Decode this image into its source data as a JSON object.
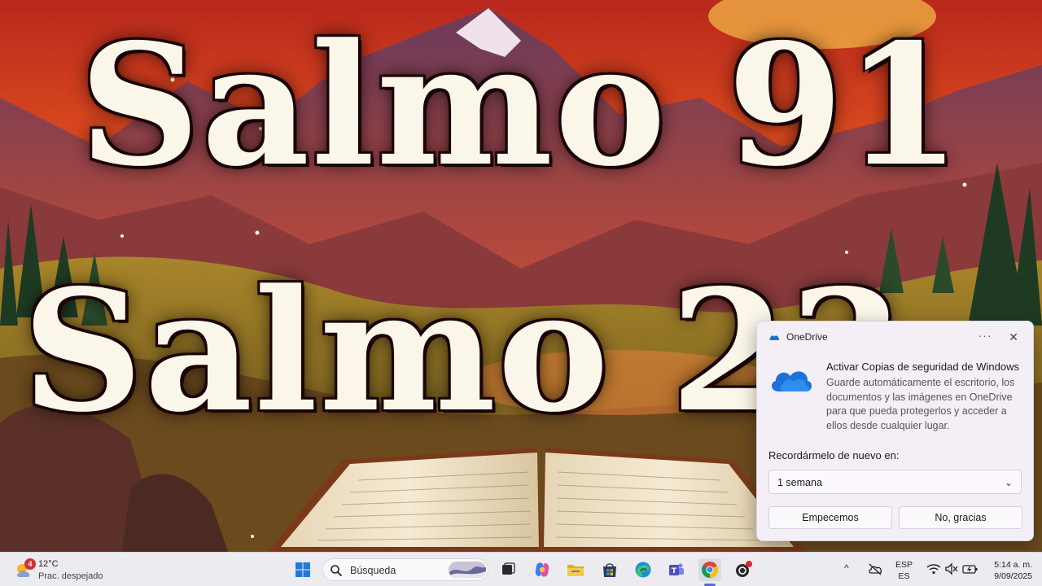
{
  "wallpaper": {
    "title_line_1": "Salmo 91",
    "title_line_2": "Salmo 23"
  },
  "toast": {
    "app_name": "OneDrive",
    "more_glyph": "···",
    "close_glyph": "✕",
    "title": "Activar Copias de seguridad de Windows",
    "body": "Guarde automáticamente el escritorio, los documentos y las imágenes en OneDrive para que pueda protegerlos y acceder a ellos desde cualquier lugar.",
    "remind_label": "Recordármelo de nuevo en:",
    "remind_selected": "1 semana",
    "primary_button": "Empecemos",
    "secondary_button": "No, gracias",
    "accent_color": "#1e6fd0"
  },
  "taskbar": {
    "weather": {
      "badge": "4",
      "temperature": "12°C",
      "description": "Prac. despejado"
    },
    "search_placeholder": "Búsqueda",
    "apps": [
      {
        "name": "start",
        "icon": "windows-logo-icon"
      },
      {
        "name": "search",
        "icon": "search-icon"
      },
      {
        "name": "task-view",
        "icon": "task-view-icon"
      },
      {
        "name": "copilot",
        "icon": "copilot-icon"
      },
      {
        "name": "file-explorer",
        "icon": "folder-icon"
      },
      {
        "name": "microsoft-store",
        "icon": "store-icon"
      },
      {
        "name": "edge",
        "icon": "edge-icon"
      },
      {
        "name": "teams",
        "icon": "teams-icon"
      },
      {
        "name": "chrome",
        "icon": "chrome-icon",
        "active": true
      },
      {
        "name": "app-with-notification",
        "icon": "app-icon"
      }
    ],
    "tray": {
      "chevron": "^",
      "language_top": "ESP",
      "language_bottom": "ES",
      "time": "5:14 a. m.",
      "date": "9/09/2025"
    }
  }
}
